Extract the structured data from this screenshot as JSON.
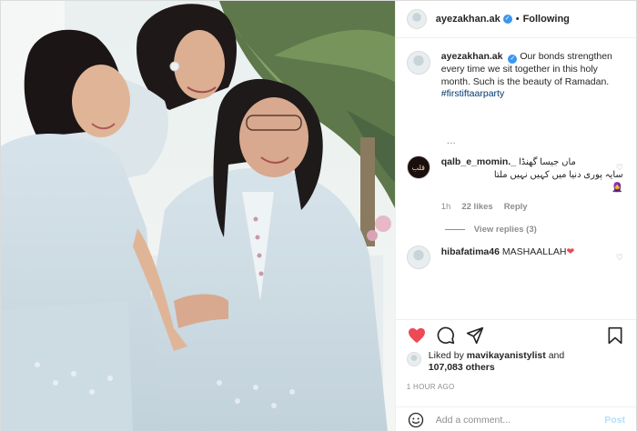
{
  "header": {
    "username": "ayezakhan.ak",
    "follow_label": "Following",
    "separator": "•"
  },
  "caption": {
    "username": "ayezakhan.ak",
    "text": "Our bonds strengthen every time we sit together in this holy month. Such is the beauty of Ramadan.",
    "hashtag": "#firstiftaarparty",
    "more": "..."
  },
  "comments": [
    {
      "username": "qalb_e_momin._",
      "text_line1": "ماں جیسا گھنڈا",
      "text_line2": "سایہ پوری دنیا میں کہیں نہیں ملتا",
      "emoji": "🧕",
      "avatar_text": "قلب",
      "time": "1h",
      "likes": "22 likes",
      "reply_label": "Reply",
      "view_replies": "View replies (3)"
    },
    {
      "username": "hibafatima46",
      "text": "MASHAALLAH",
      "emoji": "❤"
    }
  ],
  "likes": {
    "prefix": "Liked by",
    "liker": "mavikayanistylist",
    "conjunction": "and",
    "count": "107,083 others"
  },
  "timestamp": "1 HOUR AGO",
  "add_comment": {
    "placeholder": "Add a comment...",
    "post_label": "Post"
  },
  "colors": {
    "like_red": "#ed4956",
    "link_blue": "#00376b",
    "verified_blue": "#3897f0",
    "post_disabled": "#b2dffc"
  }
}
